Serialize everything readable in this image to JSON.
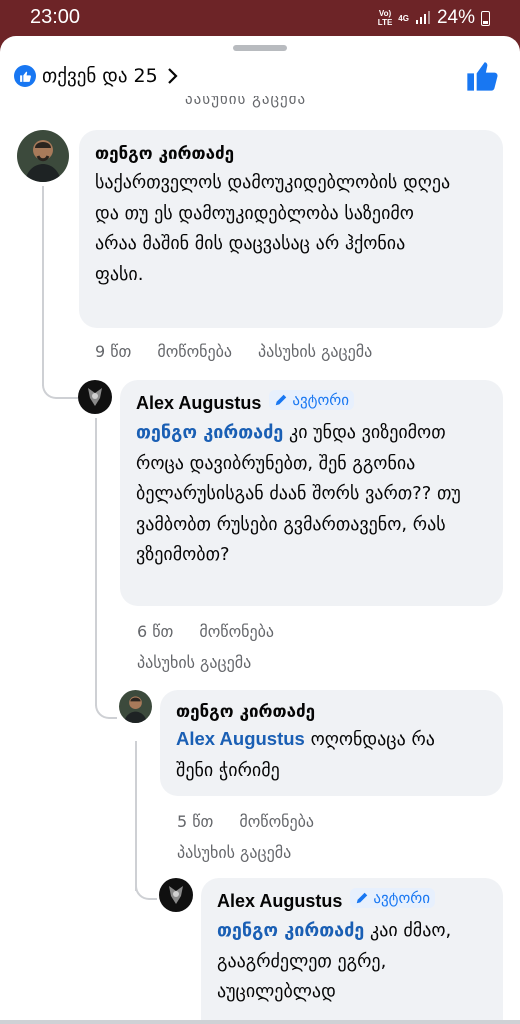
{
  "status_bar": {
    "time": "23:00",
    "volte": "Vo)) LTE",
    "net": "4G",
    "battery": "24%"
  },
  "reactions": {
    "summary": "თქვენ და 25"
  },
  "cut_text": "პასუხის გაცემა",
  "comments": [
    {
      "author": "თენგო კირთაძე",
      "text": "საქართველოს დამოუკიდებლობის დღეა და თუ ეს დამოუკიდებლობა საზეიმო არაა მაშინ მის დაცვასაც არ ჰქონია ფასი.",
      "time": "9 წთ",
      "like": "მოწონება",
      "reply": "პასუხის გაცემა"
    },
    {
      "author": "Alex Augustus",
      "badge": "ავტორი",
      "mention": "თენგო კირთაძე",
      "text": "კი უნდა ვიზეიმოთ როცა დავიბრუნებთ, შენ გგონია ბელარუსისგან ძაან შორს ვართ?? თუ ვამბობთ რუსები გვმართავენო, რას ვზეიმობთ?",
      "time": "6 წთ",
      "like": "მოწონება",
      "reply": "პასუხის გაცემა"
    },
    {
      "author": "თენგო კირთაძე",
      "mention": "Alex Augustus",
      "text": "ოღონდაცა რა შენი ჭირიმე",
      "time": "5 წთ",
      "like": "მოწონება",
      "reply": "პასუხის გაცემა"
    },
    {
      "author": "Alex Augustus",
      "badge": "ავტორი",
      "mention": "თენგო კირთაძე",
      "text": "კაი ძმაო, გააგრძელეთ ეგრე, აუცილებლად"
    }
  ],
  "colors": {
    "accent": "#1877f2",
    "mention": "#1a5fb4",
    "bubble": "#f0f2f5",
    "muted": "#65676b",
    "status_bg": "#6d2427"
  }
}
